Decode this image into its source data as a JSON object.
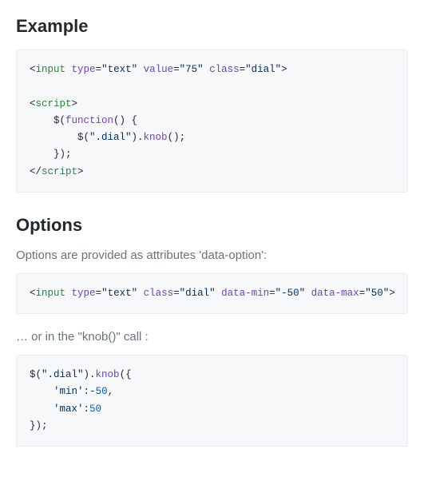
{
  "example": {
    "heading": "Example",
    "code": {
      "l1_open": "<",
      "l1_tag": "input",
      "l1_a1": " type",
      "l1_eq": "=",
      "l1_v1": "\"text\"",
      "l1_a2": " value",
      "l1_v2": "\"75\"",
      "l1_a3": " class",
      "l1_v3": "\"dial\"",
      "l1_close": ">",
      "l3_open": "<",
      "l3_tag": "script",
      "l3_close": ">",
      "l4_indent": "    $(",
      "l4_fn": "function",
      "l4_rest": "() {",
      "l5_indent": "        $(",
      "l5_sel": "\".dial\"",
      "l5_call_a": ").",
      "l5_method": "knob",
      "l5_call_b": "();",
      "l6": "    });",
      "l7_open": "</",
      "l7_tag": "script",
      "l7_close": ">"
    }
  },
  "options": {
    "heading": "Options",
    "intro": "Options are provided as attributes 'data-option':",
    "code1": {
      "open": "<",
      "tag": "input",
      "a1": " type",
      "eq": "=",
      "v1": "\"text\"",
      "a2": " class",
      "v2": "\"dial\"",
      "a3": " data-min",
      "v3": "\"-50\"",
      "a4": " data-max",
      "v4": "\"50\"",
      "close": ">"
    },
    "or_text": "… or in the \"knob()\" call :",
    "code2": {
      "l1_a": "$(",
      "l1_sel": "\".dial\"",
      "l1_b": ").",
      "l1_method": "knob",
      "l1_c": "({",
      "l2_indent": "    ",
      "l2_key": "'min'",
      "l2_sep": ":",
      "l2_minus": "-",
      "l2_val": "50",
      "l2_comma": ",",
      "l3_indent": "    ",
      "l3_key": "'max'",
      "l3_sep": ":",
      "l3_val": "50",
      "l4": "});"
    }
  }
}
